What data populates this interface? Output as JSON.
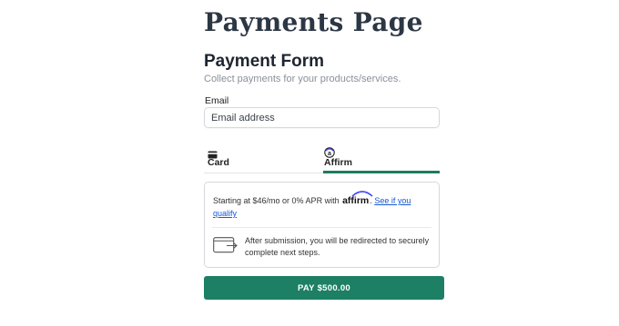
{
  "page": {
    "title": "Payments Page"
  },
  "form": {
    "title": "Payment Form",
    "description": "Collect payments for your products/services."
  },
  "email": {
    "label": "Email",
    "placeholder": "Email address"
  },
  "tabs": [
    {
      "label": "Card",
      "icon": "credit-card-icon",
      "selected": false
    },
    {
      "label": "Affirm",
      "icon": "affirm-icon",
      "selected": true
    }
  ],
  "affirm_panel": {
    "promo_prefix": "Starting at $46/mo or 0% APR with",
    "logo_text": "affirm",
    "see_if_you_qualify": "See if you qualify",
    "redirect_icon": "browser-redirect-icon",
    "redirect_text": "After submission, you will be redirected to securely complete next steps."
  },
  "pay_button": {
    "label": "PAY $500.00"
  },
  "colors": {
    "accent": "#1d7f64",
    "title": "#2c3744",
    "link": "#1558d6",
    "affirm_brand": "#4a4af4"
  }
}
